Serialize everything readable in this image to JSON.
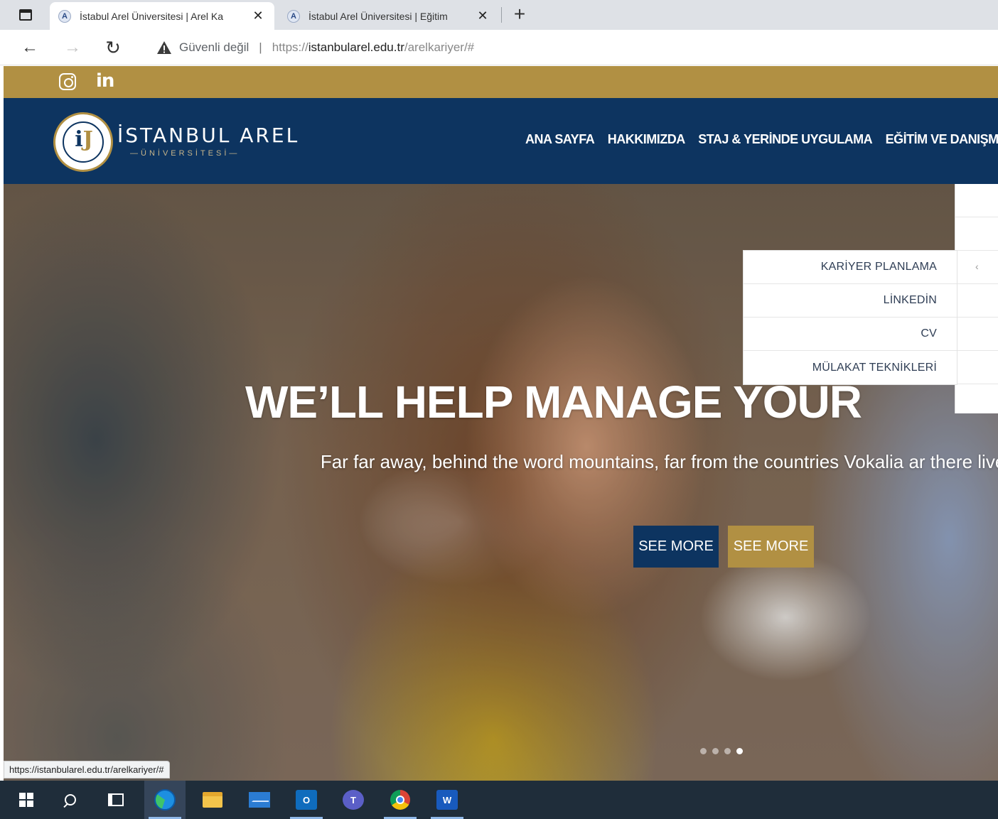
{
  "browser": {
    "tabs": [
      {
        "title": "İstabul Arel Üniversitesi | Arel Ka",
        "favicon": "A"
      },
      {
        "title": "İstabul Arel Üniversitesi | Eğitim",
        "favicon": "A"
      }
    ],
    "security_label": "Güvenli değil",
    "url_scheme": "https://",
    "url_host": "istanbularel.edu.tr",
    "url_path": "/arelkariyer/#",
    "status_url": "https://istanbularel.edu.tr/arelkariyer/#"
  },
  "site": {
    "brand": "İSTANBUL AREL",
    "brand_sub": "—ÜNİVERSİTESİ—",
    "nav": [
      "ANA SAYFA",
      "HAKKIMIZDA",
      "STAJ & YERİNDE UYGULAMA",
      "EĞİTİM VE DANIŞM"
    ],
    "dropdown": [
      "KARİYER PLANLAMA",
      "LİNKEDİN",
      "CV",
      "MÜLAKAT TEKNİKLERİ"
    ],
    "hero": {
      "title": "WE’LL HELP MANAGE YOUR",
      "subtitle": "Far far away, behind the word mountains, far from the countries Vokalia ar there live the blind texts.",
      "button_primary": "SEE MORE",
      "button_secondary": "SEE MORE",
      "slides": 4,
      "active_slide": 4
    }
  },
  "colors": {
    "navy": "#0d3460",
    "gold": "#b19043"
  },
  "taskbar": {
    "icons": [
      "windows-start-icon",
      "search-icon",
      "task-view-icon",
      "edge-icon",
      "file-explorer-icon",
      "mail-icon",
      "outlook-icon",
      "teams-icon",
      "chrome-icon",
      "word-icon"
    ]
  }
}
